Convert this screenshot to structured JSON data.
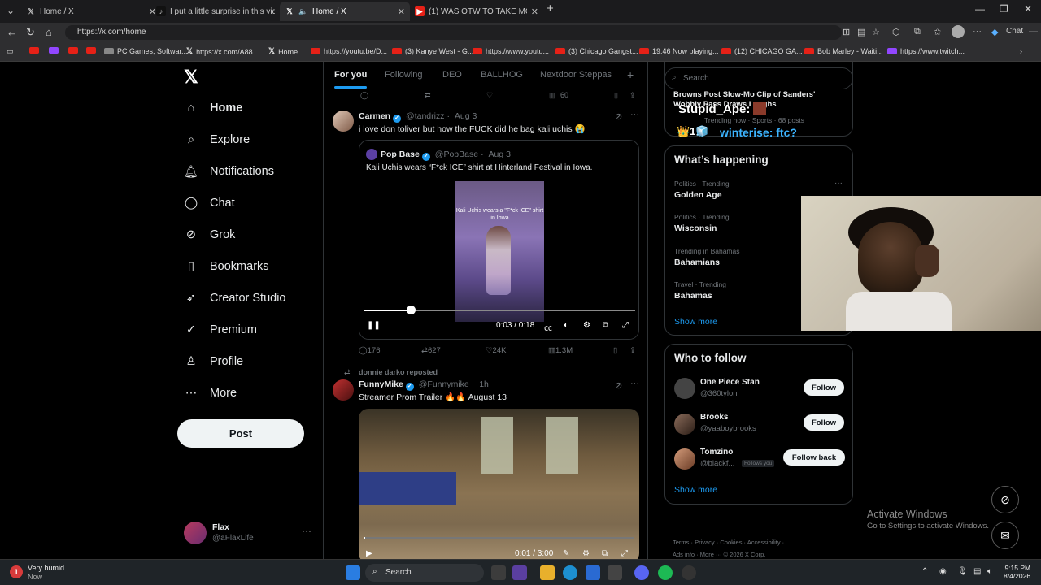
{
  "browser": {
    "tabs": [
      {
        "title": "Home / X",
        "favicon": "x-favicon"
      },
      {
        "title": "I put a little surprise in this video f",
        "favicon": "tiktok-favicon"
      },
      {
        "title": "Home / X",
        "favicon": "x-favicon"
      },
      {
        "title": "(1) WAS OTW TO TAKE MCRINGES",
        "favicon": "youtube-favicon"
      }
    ],
    "url": "https://x.com/home",
    "copilot_label": "Chat",
    "bookmarks": [
      {
        "label": "",
        "icon": "youtube"
      },
      {
        "label": "",
        "icon": "twitch"
      },
      {
        "label": "",
        "icon": "youtube"
      },
      {
        "label": "",
        "icon": "youtube"
      },
      {
        "label": "PC Games, Softwar...",
        "icon": "site"
      },
      {
        "label": "https://x.com/A88...",
        "icon": "x"
      },
      {
        "label": "Home",
        "icon": "x"
      },
      {
        "label": "https://youtu.be/D...",
        "icon": "youtube"
      },
      {
        "label": "(3) Kanye West - G...",
        "icon": "youtube"
      },
      {
        "label": "https://www.youtu...",
        "icon": "youtube"
      },
      {
        "label": "(3) Chicago Gangst...",
        "icon": "youtube"
      },
      {
        "label": "19:46 Now playing...",
        "icon": "youtube"
      },
      {
        "label": "(12) CHICAGO GA...",
        "icon": "youtube"
      },
      {
        "label": "Bob Marley - Waiti...",
        "icon": "youtube"
      },
      {
        "label": "https://www.twitch...",
        "icon": "twitch"
      }
    ]
  },
  "nav": {
    "items": [
      {
        "label": "Home",
        "icon": "home-icon"
      },
      {
        "label": "Explore",
        "icon": "search-icon"
      },
      {
        "label": "Notifications",
        "icon": "bell-icon"
      },
      {
        "label": "Chat",
        "icon": "chat-icon"
      },
      {
        "label": "Grok",
        "icon": "grok-icon"
      },
      {
        "label": "Bookmarks",
        "icon": "bookmark-icon"
      },
      {
        "label": "Creator Studio",
        "icon": "rocket-icon"
      },
      {
        "label": "Premium",
        "icon": "verified-icon"
      },
      {
        "label": "Profile",
        "icon": "person-icon"
      },
      {
        "label": "More",
        "icon": "more-circle-icon"
      }
    ],
    "post_label": "Post",
    "account": {
      "name": "Flax",
      "handle": "@aFlaxLife"
    }
  },
  "timeline": {
    "tabs": [
      "For you",
      "Following",
      "DEO",
      "BALLHOG",
      "Nextdoor Steppas"
    ],
    "prev_views": "60",
    "tweet1": {
      "name": "Carmen",
      "handle": "@tandrizz",
      "date": "Aug 3",
      "text": "i love don toliver but how the FUCK did he bag kali uchis 😭",
      "quote": {
        "name": "Pop Base",
        "handle": "@PopBase",
        "date": "Aug 3",
        "text": "Kali Uchis wears “F*ck ICE” shirt at Hinterland Festival in Iowa.",
        "video_caption": "Kali Uchis wears a \"F*ck ICE\" shirt in Iowa",
        "time": "0:03 / 0:18",
        "progress": 0.17
      },
      "replies": "176",
      "reposts": "627",
      "likes": "24K",
      "views": "1.3M"
    },
    "tweet2": {
      "reposted_by": "donnie darko reposted",
      "name": "FunnyMike",
      "handle": "@Funnymike",
      "date": "1h",
      "text": "Streamer Prom Trailer 🔥🔥 August 13",
      "time": "0:01 / 3:00",
      "progress": 0.006
    }
  },
  "right": {
    "search_placeholder": "Search",
    "top_trend": {
      "title": "Browns Post Slow-Mo Clip of Sanders' Wobbly Pass Draws Laughs",
      "meta": "Trending now · Sports · 68 posts"
    },
    "whats_happening": {
      "title": "What’s happening",
      "trends": [
        {
          "sub": "Politics · Trending",
          "title": "Golden Age"
        },
        {
          "sub": "Politics · Trending",
          "title": "Wisconsin"
        },
        {
          "sub": "Trending in Bahamas",
          "title": "Bahamians"
        },
        {
          "sub": "Travel · Trending",
          "title": "Bahamas"
        }
      ],
      "show_more": "Show more"
    },
    "who_to_follow": {
      "title": "Who to follow",
      "accounts": [
        {
          "name": "One Piece Stan",
          "handle": "@360tylon",
          "button": "Follow",
          "follows_you": ""
        },
        {
          "name": "Brooks",
          "handle": "@yaaboybrooks",
          "button": "Follow",
          "follows_you": ""
        },
        {
          "name": "Tomzino",
          "handle": "@blackf...",
          "button": "Follow back",
          "follows_you": "Follows you"
        }
      ],
      "show_more": "Show more"
    },
    "footer": [
      "Terms",
      "Privacy",
      "Cookies",
      "Accessibility",
      "Ads info",
      "More ···",
      "© 2026 X Corp."
    ]
  },
  "overlay": {
    "line1": "Stupid_Ape:",
    "line2": "winterise: ftc?",
    "badges": "👑1🧊"
  },
  "windows_watermark": {
    "line1": "Activate Windows",
    "line2": "Go to Settings to activate Windows."
  },
  "taskbar": {
    "weather_temp": "1",
    "weather_text": "Very humid",
    "weather_sub": "Now",
    "search_label": "Search",
    "time": "9:15 PM",
    "date": "8/4/2026"
  },
  "colors": {
    "accent": "#1d9bf0",
    "background": "#000000",
    "text": "#e7e9ea",
    "muted": "#71767b"
  }
}
